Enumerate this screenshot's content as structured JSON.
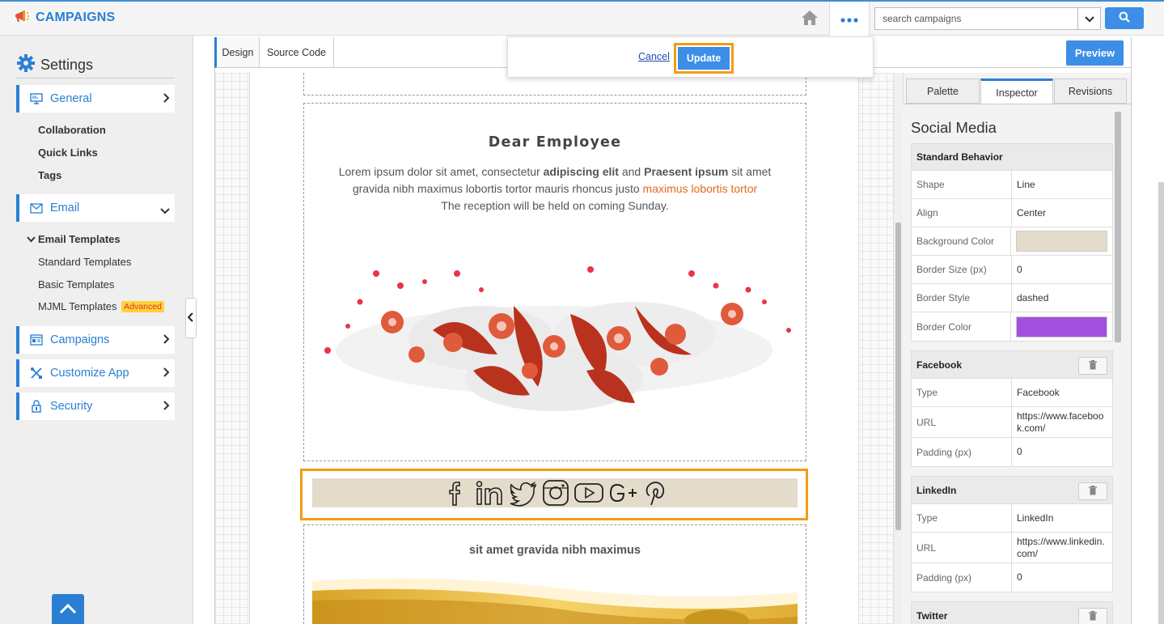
{
  "app": {
    "name": "CAMPAIGNS"
  },
  "search": {
    "placeholder": "search campaigns"
  },
  "sidebar": {
    "title": "Settings",
    "items": [
      {
        "label": "General",
        "icon": "monitor-icon",
        "subitems": [
          "Collaboration",
          "Quick Links",
          "Tags"
        ]
      },
      {
        "label": "Email",
        "icon": "envelope-icon"
      },
      {
        "label": "Campaigns",
        "icon": "campaign-icon"
      },
      {
        "label": "Customize App",
        "icon": "tools-icon"
      },
      {
        "label": "Security",
        "icon": "lock-icon"
      }
    ],
    "email_templates": {
      "label": "Email Templates",
      "subitems": [
        "Standard Templates",
        "Basic Templates",
        "MJML Templates"
      ],
      "badge": "Advanced"
    }
  },
  "editor": {
    "tabs": [
      "Design",
      "Source Code"
    ],
    "preview_label": "Preview",
    "popup": {
      "cancel_label": "Cancel",
      "update_label": "Update"
    }
  },
  "email": {
    "headline": "Dear Employee",
    "para_part1": "Lorem ipsum dolor sit amet, consectetur ",
    "para_bold1": "adipiscing elit",
    "para_part2": " and ",
    "para_bold2": "Praesent ipsum",
    "para_part3": " sit amet gravida nibh maximus lobortis tortor mauris rhoncus justo ",
    "para_highlight": "maximus lobortis tortor",
    "para_line3": "The reception will be held on coming Sunday.",
    "sub_headline": "sit amet gravida nibh maximus",
    "social_icons": [
      "facebook-icon",
      "linkedin-icon",
      "twitter-icon",
      "instagram-icon",
      "youtube-icon",
      "google-plus-icon",
      "pinterest-icon"
    ]
  },
  "inspector": {
    "tabs": [
      "Palette",
      "Inspector",
      "Revisions"
    ],
    "title": "Social Media",
    "standard": {
      "header": "Standard Behavior",
      "rows": [
        {
          "key": "Shape",
          "value": "Line"
        },
        {
          "key": "Align",
          "value": "Center"
        },
        {
          "key": "Background Color",
          "color": "#e3dccb"
        },
        {
          "key": "Border Size (px)",
          "value": "0"
        },
        {
          "key": "Border Style",
          "value": "dashed"
        },
        {
          "key": "Border Color",
          "color": "#a24fe0"
        }
      ]
    },
    "facebook": {
      "header": "Facebook",
      "rows": [
        {
          "key": "Type",
          "value": "Facebook"
        },
        {
          "key": "URL",
          "value": "https://www.facebook.com/"
        },
        {
          "key": "Padding (px)",
          "value": "0"
        }
      ]
    },
    "linkedin": {
      "header": "LinkedIn",
      "rows": [
        {
          "key": "Type",
          "value": "LinkedIn"
        },
        {
          "key": "URL",
          "value": "https://www.linkedin.com/"
        },
        {
          "key": "Padding (px)",
          "value": "0"
        }
      ]
    },
    "twitter": {
      "header": "Twitter"
    }
  },
  "colors": {
    "accent": "#2a7fd3",
    "button": "#3c8ee6",
    "selection": "#f39c12",
    "link_highlight": "#e16a1d"
  }
}
